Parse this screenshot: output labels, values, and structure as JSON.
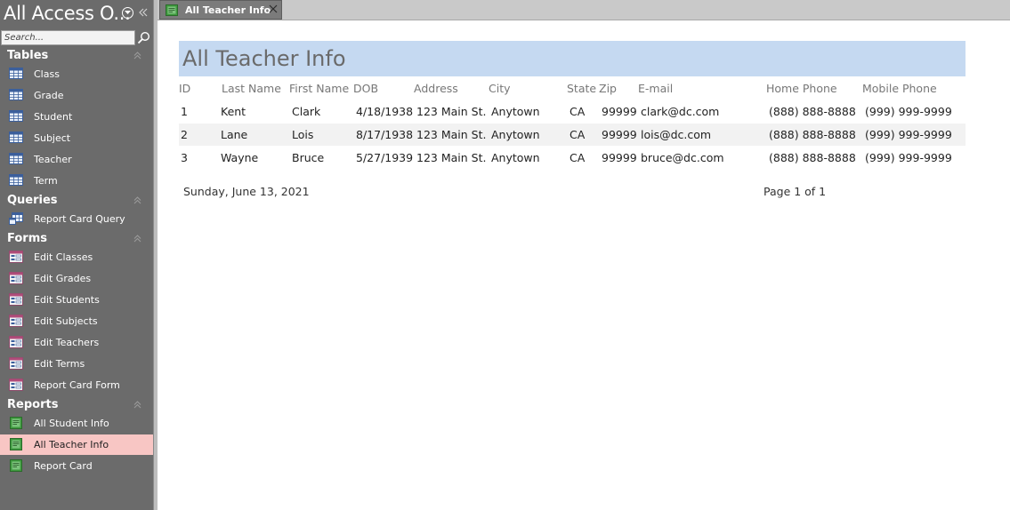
{
  "nav": {
    "title": "All Access O...",
    "search_placeholder": "Search...",
    "sections": [
      {
        "label": "Tables",
        "items": [
          {
            "label": "Class",
            "icon": "table-icon"
          },
          {
            "label": "Grade",
            "icon": "table-icon"
          },
          {
            "label": "Student",
            "icon": "table-icon"
          },
          {
            "label": "Subject",
            "icon": "table-icon"
          },
          {
            "label": "Teacher",
            "icon": "table-icon"
          },
          {
            "label": "Term",
            "icon": "table-icon"
          }
        ]
      },
      {
        "label": "Queries",
        "items": [
          {
            "label": "Report Card Query",
            "icon": "query-icon"
          }
        ]
      },
      {
        "label": "Forms",
        "items": [
          {
            "label": "Edit Classes",
            "icon": "form-icon"
          },
          {
            "label": "Edit Grades",
            "icon": "form-icon"
          },
          {
            "label": "Edit Students",
            "icon": "form-icon"
          },
          {
            "label": "Edit Subjects",
            "icon": "form-icon"
          },
          {
            "label": "Edit Teachers",
            "icon": "form-icon"
          },
          {
            "label": "Edit Terms",
            "icon": "form-icon"
          },
          {
            "label": "Report Card Form",
            "icon": "form-icon"
          }
        ]
      },
      {
        "label": "Reports",
        "items": [
          {
            "label": "All Student Info",
            "icon": "report-icon"
          },
          {
            "label": "All Teacher Info",
            "icon": "report-icon",
            "selected": true
          },
          {
            "label": "Report Card",
            "icon": "report-icon"
          }
        ]
      }
    ]
  },
  "tab": {
    "label": "All Teacher Info"
  },
  "report": {
    "title": "All Teacher Info",
    "columns": [
      "ID",
      "Last Name",
      "First Name",
      "DOB",
      "Address",
      "City",
      "State",
      "Zip",
      "E-mail",
      "Home Phone",
      "Mobile Phone"
    ],
    "rows": [
      [
        "1",
        "Kent",
        "Clark",
        "4/18/1938",
        "123 Main St.",
        "Anytown",
        "CA",
        "99999",
        "clark@dc.com",
        "(888) 888-8888",
        "(999) 999-9999"
      ],
      [
        "2",
        "Lane",
        "Lois",
        "8/17/1938",
        "123 Main St.",
        "Anytown",
        "CA",
        "99999",
        "lois@dc.com",
        "(888) 888-8888",
        "(999) 999-9999"
      ],
      [
        "3",
        "Wayne",
        "Bruce",
        "5/27/1939",
        "123 Main St.",
        "Anytown",
        "CA",
        "99999",
        "bruce@dc.com",
        "(888) 888-8888",
        "(999) 999-9999"
      ]
    ],
    "footer_date": "Sunday, June 13, 2021",
    "footer_page": "Page 1 of 1"
  },
  "colors": {
    "nav_background": "#6b6b6b",
    "selected_item": "#f8c6c4",
    "title_band": "#c5d9f1",
    "alt_row": "#f2f2f2",
    "tab_background": "#7b7b7b"
  }
}
